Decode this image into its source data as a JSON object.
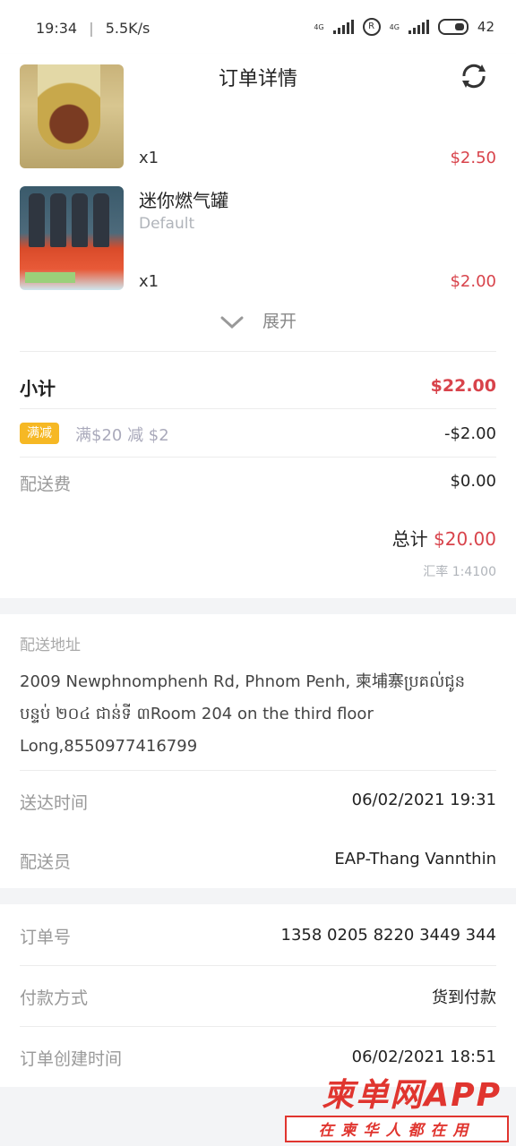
{
  "status_bar": {
    "time": "19:34",
    "net_speed": "5.5K/s",
    "net1": "4G",
    "net2": "4G",
    "battery": "42"
  },
  "header": {
    "title": "订单详情",
    "back_icon": "back-arrow-icon",
    "refresh_icon": "refresh-icon"
  },
  "items": [
    {
      "name": "",
      "variant": "",
      "qty": "x1",
      "price": "$2.50"
    },
    {
      "name": "迷你燃气罐",
      "variant": "Default",
      "qty": "x1",
      "price": "$2.00"
    }
  ],
  "expand_label": "展开",
  "summary": {
    "subtotal_label": "小计",
    "subtotal_value": "$22.00",
    "promo_badge": "满减",
    "promo_text": "满$20 减 $2",
    "promo_value": "-$2.00",
    "delivery_fee_label": "配送费",
    "delivery_fee_value": "$0.00",
    "total_label": "总计",
    "total_value": "$20.00",
    "exchange_rate": "汇率 1:4100"
  },
  "address": {
    "label": "配送地址",
    "line1": "2009 Newphnomphenh Rd, Phnom Penh, 柬埔寨ប្រគល់ជូន",
    "line2": "បន្ទប់ ២០៤ ជាន់ទី ៣Room 204 on the third floor",
    "line3": "Long,8550977416799"
  },
  "delivery": {
    "time_label": "送达时间",
    "time_value": "06/02/2021 19:31",
    "courier_label": "配送员",
    "courier_value": "EAP-Thang Vannthin"
  },
  "order": {
    "number_label": "订单号",
    "number_value": "1358 0205 8220 3449 344",
    "payment_label": "付款方式",
    "payment_value": "货到付款",
    "created_label": "订单创建时间",
    "created_value": "06/02/2021 18:51"
  },
  "watermark": {
    "top": "柬单网APP",
    "bottom": "在柬华人都在用"
  },
  "colors": {
    "price": "#d8434b",
    "badge": "#f6b824",
    "watermark": "#e0352f"
  }
}
